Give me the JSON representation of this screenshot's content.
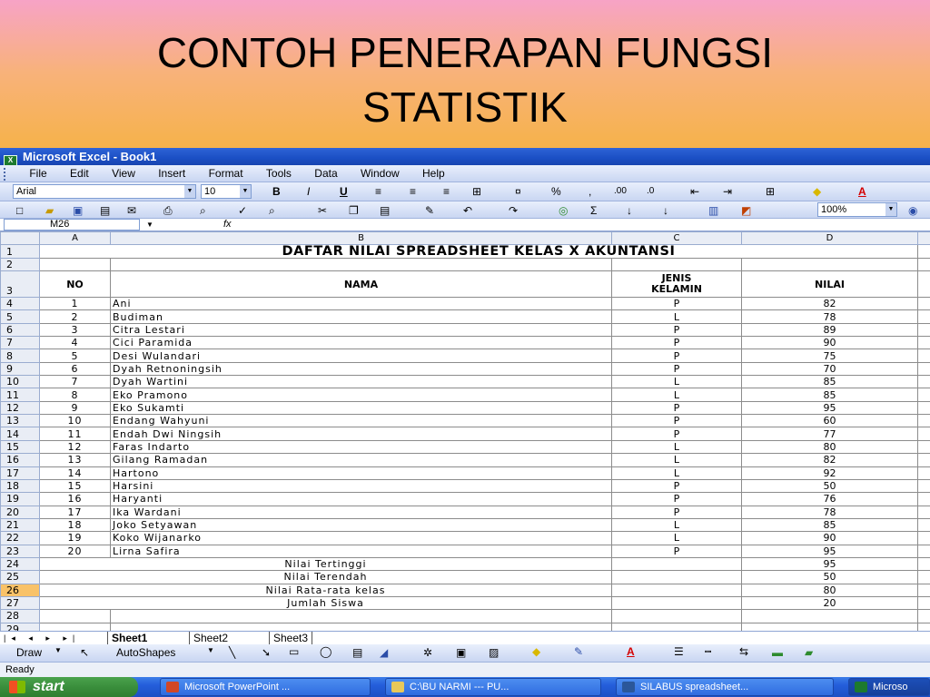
{
  "slide": {
    "title_line1": "CONTOH PENERAPAN FUNGSI",
    "title_line2": "STATISTIK"
  },
  "window": {
    "title": "Microsoft Excel - Book1"
  },
  "menu": [
    "File",
    "Edit",
    "View",
    "Insert",
    "Format",
    "Tools",
    "Data",
    "Window",
    "Help"
  ],
  "format_toolbar": {
    "font": "Arial",
    "size": "10",
    "bold": "B",
    "italic": "I",
    "underline": "U",
    "percent": "%",
    "comma": ",",
    "inc_decimal": ".00",
    "dec_decimal": ".0"
  },
  "standard_toolbar": {
    "sigma": "Σ",
    "zoom": "100%"
  },
  "namebox": {
    "value": "M26",
    "fx": "fx"
  },
  "columns": [
    "A",
    "B",
    "C",
    "D"
  ],
  "sheet": {
    "title": "DAFTAR NILAI SPREADSHEET KELAS X AKUNTANSI",
    "headers": {
      "no": "NO",
      "nama": "NAMA",
      "jk_line1": "JENIS",
      "jk_line2": "KELAMIN",
      "nilai": "NILAI"
    },
    "rows": [
      {
        "no": "1",
        "nama": "Ani",
        "jk": "P",
        "nilai": "82"
      },
      {
        "no": "2",
        "nama": "Budiman",
        "jk": "L",
        "nilai": "78"
      },
      {
        "no": "3",
        "nama": "Citra Lestari",
        "jk": "P",
        "nilai": "89"
      },
      {
        "no": "4",
        "nama": "Cici Paramida",
        "jk": "P",
        "nilai": "90"
      },
      {
        "no": "5",
        "nama": "Desi Wulandari",
        "jk": "P",
        "nilai": "75"
      },
      {
        "no": "6",
        "nama": "Dyah Retnoningsih",
        "jk": "P",
        "nilai": "70"
      },
      {
        "no": "7",
        "nama": "Dyah Wartini",
        "jk": "L",
        "nilai": "85"
      },
      {
        "no": "8",
        "nama": "Eko Pramono",
        "jk": "L",
        "nilai": "85"
      },
      {
        "no": "9",
        "nama": "Eko Sukamti",
        "jk": "P",
        "nilai": "95"
      },
      {
        "no": "10",
        "nama": "Endang Wahyuni",
        "jk": "P",
        "nilai": "60"
      },
      {
        "no": "11",
        "nama": "Endah Dwi Ningsih",
        "jk": "P",
        "nilai": "77"
      },
      {
        "no": "12",
        "nama": "Faras Indarto",
        "jk": "L",
        "nilai": "80"
      },
      {
        "no": "13",
        "nama": "Gilang Ramadan",
        "jk": "L",
        "nilai": "82"
      },
      {
        "no": "14",
        "nama": "Hartono",
        "jk": "L",
        "nilai": "92"
      },
      {
        "no": "15",
        "nama": "Harsini",
        "jk": "P",
        "nilai": "50"
      },
      {
        "no": "16",
        "nama": "Haryanti",
        "jk": "P",
        "nilai": "76"
      },
      {
        "no": "17",
        "nama": "Ika Wardani",
        "jk": "P",
        "nilai": "78"
      },
      {
        "no": "18",
        "nama": "Joko Setyawan",
        "jk": "L",
        "nilai": "85"
      },
      {
        "no": "19",
        "nama": "Koko Wijanarko",
        "jk": "L",
        "nilai": "90"
      },
      {
        "no": "20",
        "nama": "Lirna Safira",
        "jk": "P",
        "nilai": "95"
      }
    ],
    "summary": [
      {
        "label": "Nilai Tertinggi",
        "value": "95"
      },
      {
        "label": "Nilai Terendah",
        "value": "50"
      },
      {
        "label": "Nilai Rata-rata kelas",
        "value": "80"
      },
      {
        "label": "Jumlah Siswa",
        "value": "20"
      }
    ],
    "active_row": "26"
  },
  "sheet_tabs": [
    "Sheet1",
    "Sheet2",
    "Sheet3"
  ],
  "drawing_toolbar": {
    "draw": "Draw",
    "autoshapes": "AutoShapes"
  },
  "status": {
    "text": "Ready"
  },
  "taskbar": {
    "start": "start",
    "tasks": [
      "Microsoft PowerPoint ...",
      "C:\\BU NARMI  ---  PU...",
      "SILABUS spreadsheet...",
      "Microso"
    ]
  },
  "colors": {
    "titlebar": "#1b4fc4",
    "start_button": "#3a8e3c",
    "taskbar": "#245edb",
    "active_row_header": "#f9c268"
  }
}
